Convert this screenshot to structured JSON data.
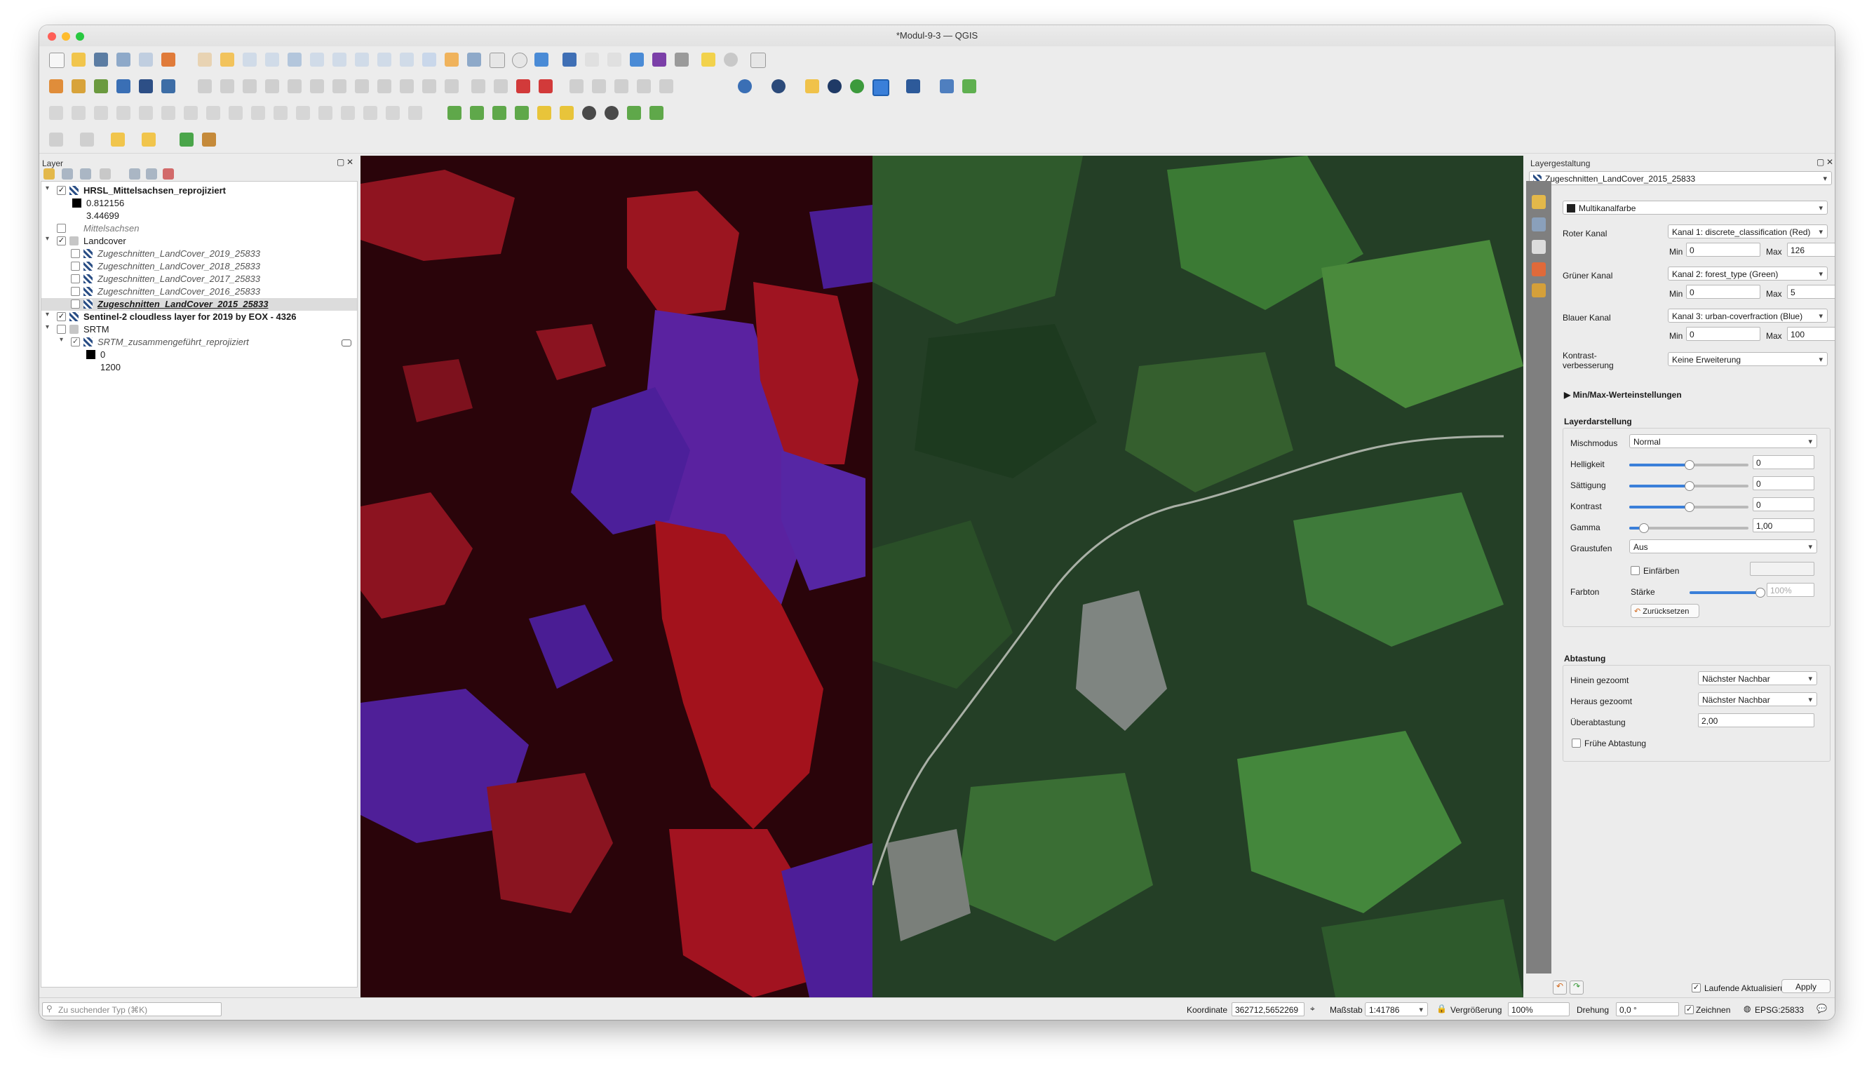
{
  "window": {
    "title": "*Modul-9-3 — QGIS"
  },
  "layers_panel": {
    "title": "Layer",
    "items": [
      {
        "label": "HRSL_Mittelsachsen_reprojiziert",
        "bold": true,
        "checked": true
      },
      {
        "label": "0.812156"
      },
      {
        "label": "3.44699"
      },
      {
        "label": "Mittelsachsen",
        "italic": true,
        "checked": false
      },
      {
        "label": "Landcover",
        "checked": true
      },
      {
        "label": "Zugeschnitten_LandCover_2019_25833",
        "italic": true,
        "checked": false
      },
      {
        "label": "Zugeschnitten_LandCover_2018_25833",
        "italic": true,
        "checked": false
      },
      {
        "label": "Zugeschnitten_LandCover_2017_25833",
        "italic": true,
        "checked": false
      },
      {
        "label": "Zugeschnitten_LandCover_2016_25833",
        "italic": true,
        "checked": false
      },
      {
        "label": "Zugeschnitten_LandCover_2015_25833",
        "italic": true,
        "bold": true,
        "checked": false,
        "selected": true
      },
      {
        "label": "Sentinel-2 cloudless layer for 2019 by EOX - 4326",
        "bold": true,
        "checked": true
      },
      {
        "label": "SRTM",
        "checked": false
      },
      {
        "label": "SRTM_zusammengeführt_reprojiziert",
        "italic": true,
        "checked": true
      },
      {
        "label": "0"
      },
      {
        "label": "1200"
      }
    ],
    "search_placeholder": "Zu suchender Typ (⌘K)"
  },
  "style_panel": {
    "title": "Layergestaltung",
    "layer_select": "Zugeschnitten_LandCover_2015_25833",
    "renderer": "Multikanalfarbe",
    "red": {
      "label": "Roter Kanal",
      "band": "Kanal 1: discrete_classification (Red)",
      "min": "0",
      "max": "126"
    },
    "green": {
      "label": "Grüner Kanal",
      "band": "Kanal 2: forest_type (Green)",
      "min": "0",
      "max": "5"
    },
    "blue": {
      "label": "Blauer Kanal",
      "band": "Kanal 3: urban-coverfraction (Blue)",
      "min": "0",
      "max": "100"
    },
    "min_label": "Min",
    "max_label": "Max",
    "contrast_label_1": "Kontrast-",
    "contrast_label_2": "verbesserung",
    "contrast_value": "Keine Erweiterung",
    "minmax_section": "Min/Max-Werteinstellungen",
    "rendering_title": "Layerdarstellung",
    "blend_label": "Mischmodus",
    "blend_value": "Normal",
    "brightness_label": "Helligkeit",
    "brightness_value": "0",
    "saturation_label": "Sättigung",
    "saturation_value": "0",
    "contrast2_label": "Kontrast",
    "contrast2_value": "0",
    "gamma_label": "Gamma",
    "gamma_value": "1,00",
    "grayscale_label": "Graustufen",
    "grayscale_value": "Aus",
    "hue_label": "Farbton",
    "colorize_label": "Einfärben",
    "strength_label": "Stärke",
    "strength_value": "100%",
    "reset_label": "Zurücksetzen",
    "sampling_title": "Abtastung",
    "zoomed_in_label": "Hinein gezoomt",
    "zoomed_in_value": "Nächster Nachbar",
    "zoomed_out_label": "Heraus gezoomt",
    "zoomed_out_value": "Nächster Nachbar",
    "oversampling_label": "Überabtastung",
    "oversampling_value": "2,00",
    "early_sampling_label": "Frühe Abtastung",
    "live_update_label": "Laufende Aktualisierung",
    "apply_label": "Apply"
  },
  "statusbar": {
    "coord_label": "Koordinate",
    "coord_value": "362712,5652269",
    "scale_label": "Maßstab",
    "scale_value": "1:41786",
    "magnifier_label": "Vergrößerung",
    "magnifier_value": "100%",
    "rotation_label": "Drehung",
    "rotation_value": "0,0 °",
    "render_label": "Zeichnen",
    "crs_label": "EPSG:25833"
  },
  "colors": {
    "accent": "#3a7fd9",
    "map_red": "#a3121c",
    "map_dark": "#2a040a",
    "map_blue": "#4c1f9a",
    "map_green": "#2e5a2c"
  }
}
